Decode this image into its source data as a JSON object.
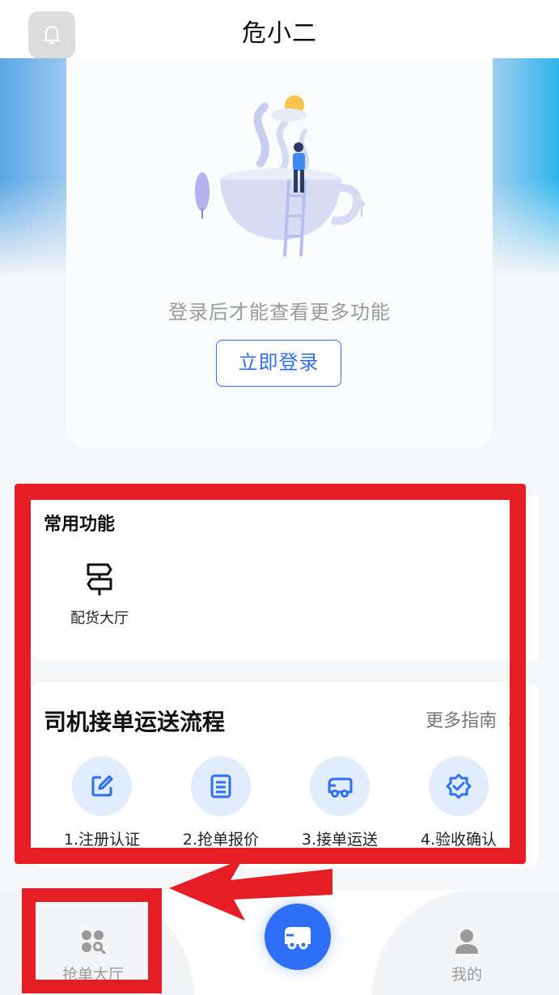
{
  "header": {
    "title": "危小二",
    "bell_icon": "bell-icon"
  },
  "login": {
    "tip": "登录后才能查看更多功能",
    "button_label": "立即登录"
  },
  "common_functions": {
    "title": "常用功能",
    "items": [
      {
        "label": "配货大厅",
        "icon": "signpost-icon"
      }
    ]
  },
  "process": {
    "title": "司机接单运送流程",
    "more_label": "更多指南",
    "steps": [
      {
        "label": "1.注册认证",
        "icon": "edit-icon"
      },
      {
        "label": "2.抢单报价",
        "icon": "document-icon"
      },
      {
        "label": "3.接单运送",
        "icon": "truck-icon"
      },
      {
        "label": "4.验收确认",
        "icon": "verified-badge-icon"
      }
    ]
  },
  "tabbar": {
    "items": [
      {
        "label": "抢单大厅",
        "icon": "grab-order-icon"
      },
      {
        "label": "",
        "icon": "truck-icon"
      },
      {
        "label": "我的",
        "icon": "user-icon"
      }
    ]
  },
  "colors": {
    "accent": "#2f6ff6",
    "step_circle": "#e1ecfd",
    "annotation_red": "#e51d24"
  }
}
